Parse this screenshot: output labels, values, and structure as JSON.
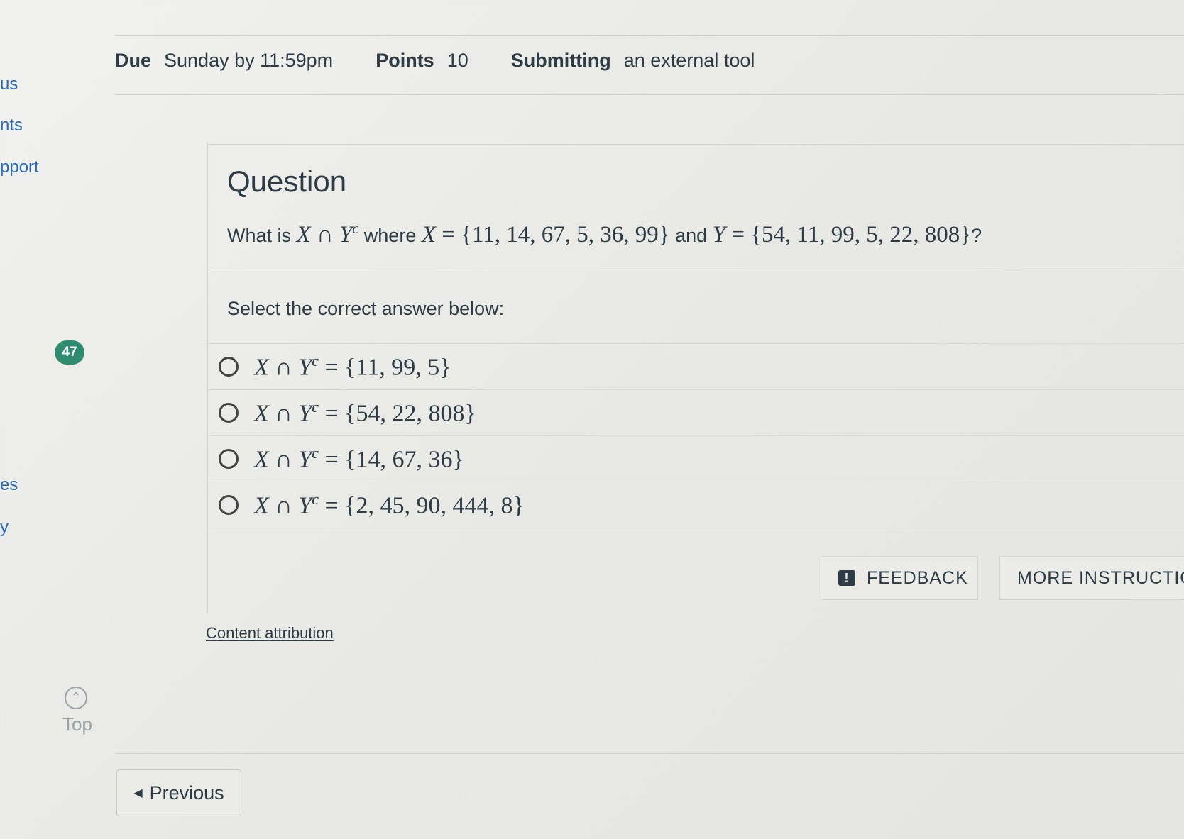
{
  "left_nav": [
    "us",
    "nts",
    "pport",
    "es",
    "y"
  ],
  "badge_count": "47",
  "meta": {
    "due_label": "Due",
    "due_value": "Sunday by 11:59pm",
    "points_label": "Points",
    "points_value": "10",
    "submitting_label": "Submitting",
    "submitting_value": "an external tool"
  },
  "question": {
    "title": "Question",
    "prompt_prefix": "What is",
    "prompt_expr": "X ∩ Y",
    "prompt_sup": "c",
    "prompt_where": "where",
    "x_var": "X",
    "x_set": "= {11, 14, 67, 5, 36, 99}",
    "and_word": "and",
    "y_var": "Y",
    "y_set": "= {54, 11, 99, 5, 22, 808}",
    "qmark": "?",
    "select_text": "Select the correct answer below:"
  },
  "options": [
    {
      "lhs": "X ∩ Y",
      "sup": "c",
      "rhs": "= {11, 99, 5}"
    },
    {
      "lhs": "X ∩ Y",
      "sup": "c",
      "rhs": "= {54, 22, 808}"
    },
    {
      "lhs": "X ∩ Y",
      "sup": "c",
      "rhs": "= {14, 67, 36}"
    },
    {
      "lhs": "X ∩ Y",
      "sup": "c",
      "rhs": "= {2, 45, 90, 444, 8}"
    }
  ],
  "buttons": {
    "feedback": "FEEDBACK",
    "more_instructions": "MORE INSTRUCTIO"
  },
  "content_attribution": "Content attribution",
  "top_label": "Top",
  "previous_label": "Previous",
  "icons": {
    "feedback": "feedback-icon",
    "top": "chevron-up-icon",
    "previous": "caret-left-icon"
  }
}
